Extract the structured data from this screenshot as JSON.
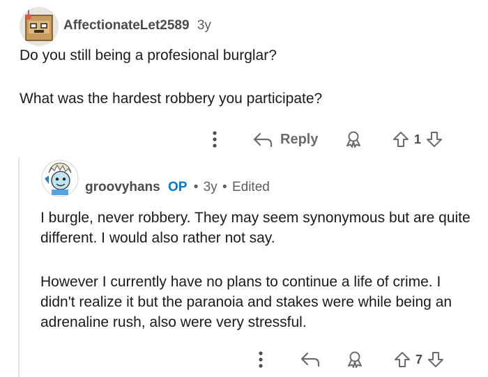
{
  "comments": [
    {
      "username": "AffectionateLet2589",
      "age": "3y",
      "paragraphs": [
        "Do you still being a profesional burglar?",
        "What was the hardest robbery you participate?"
      ],
      "actions": {
        "reply_label": "Reply",
        "votes": "1"
      },
      "icons": [
        "more-icon",
        "reply-arrow-icon",
        "award-icon",
        "upvote-icon",
        "downvote-icon"
      ]
    },
    {
      "username": "groovyhans",
      "op_badge": "OP",
      "separator": "•",
      "age": "3y",
      "edited": "Edited",
      "paragraphs": [
        "I burgle, never robbery. They may seem synonymous but are quite different. I would also rather not say.",
        "However I currently have no plans to continue a life of crime. I didn't realize it but the paranoia and stakes were while being an adrenaline rush, also were very stressful."
      ],
      "actions": {
        "votes": "7"
      },
      "icons": [
        "more-icon",
        "reply-arrow-icon",
        "award-icon",
        "upvote-icon",
        "downvote-icon"
      ]
    }
  ],
  "colors": {
    "text": "#1a1a1b",
    "meta": "#5c5c5d",
    "op": "#0079d3",
    "icon": "#6b6b6c",
    "thread": "#e2e2e2"
  }
}
